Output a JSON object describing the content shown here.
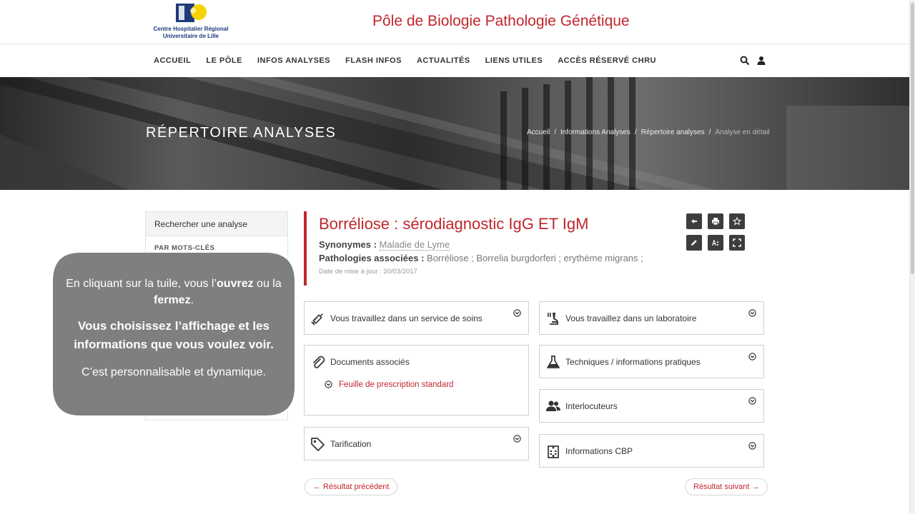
{
  "header": {
    "logo_line1": "Centre Hospitalier Régional",
    "logo_line2": "Universitaire de Lille",
    "site_title": "Pôle de Biologie Pathologie Génétique"
  },
  "nav": {
    "items": [
      "ACCUEIL",
      "LE PÔLE",
      "INFOS ANALYSES",
      "FLASH INFOS",
      "ACTUALITÉS",
      "LIENS UTILES",
      "ACCÈS RÉSERVÉ CHRU"
    ],
    "icons": [
      "search-icon",
      "user-icon"
    ]
  },
  "banner": {
    "title": "RÉPERTOIRE ANALYSES",
    "breadcrumb": [
      "Accueil",
      "Informations Analyses",
      "Répertoire analyses",
      "Analyse en détail"
    ]
  },
  "sidebar": {
    "heading": "Rechercher une analyse",
    "subheading": "PAR MOTS-CLÉS"
  },
  "analysis": {
    "title": "Borréliose : sérodiagnostic IgG ET IgM",
    "synonyms_label": "Synonymes :",
    "synonyms_value": "Maladie de Lyme",
    "pathologies_label": "Pathologies associées :",
    "pathologies_value": "Borréliose ; Borrelia burgdorferi ; erythème migrans ;",
    "date": "Date de mise à jour : 20/03/2017"
  },
  "toolbar": {
    "icons": [
      "back-icon",
      "print-icon",
      "star-icon",
      "edit-icon",
      "font-size-icon",
      "fullscreen-icon"
    ]
  },
  "tiles": {
    "soins": "Vous travaillez dans un service de soins",
    "labo": "Vous travaillez dans un laboratoire",
    "documents": "Documents associés",
    "documents_link": "Feuille de prescription standard",
    "techniques": "Techniques / informations pratiques",
    "interlocuteurs": "Interlocuteurs",
    "tarification": "Tarification",
    "cbp": "Informations CBP"
  },
  "pager": {
    "prev": "← Résultat précédent",
    "next": "Résultat suivant →"
  },
  "callout": {
    "line1_a": "En cliquant sur la tuile, vous l’",
    "line1_b": "ouvrez",
    "line1_c": " ou la ",
    "line1_d": "fermez",
    "line1_e": ".",
    "line2": "Vous choisissez l’affichage et les informations que vous voulez voir.",
    "line3": "C’est personnalisable et dynamique."
  },
  "colors": {
    "accent": "#c0272d",
    "callout_bg": "#7f7f7f",
    "toolbar_bg": "#3d3d3d"
  }
}
